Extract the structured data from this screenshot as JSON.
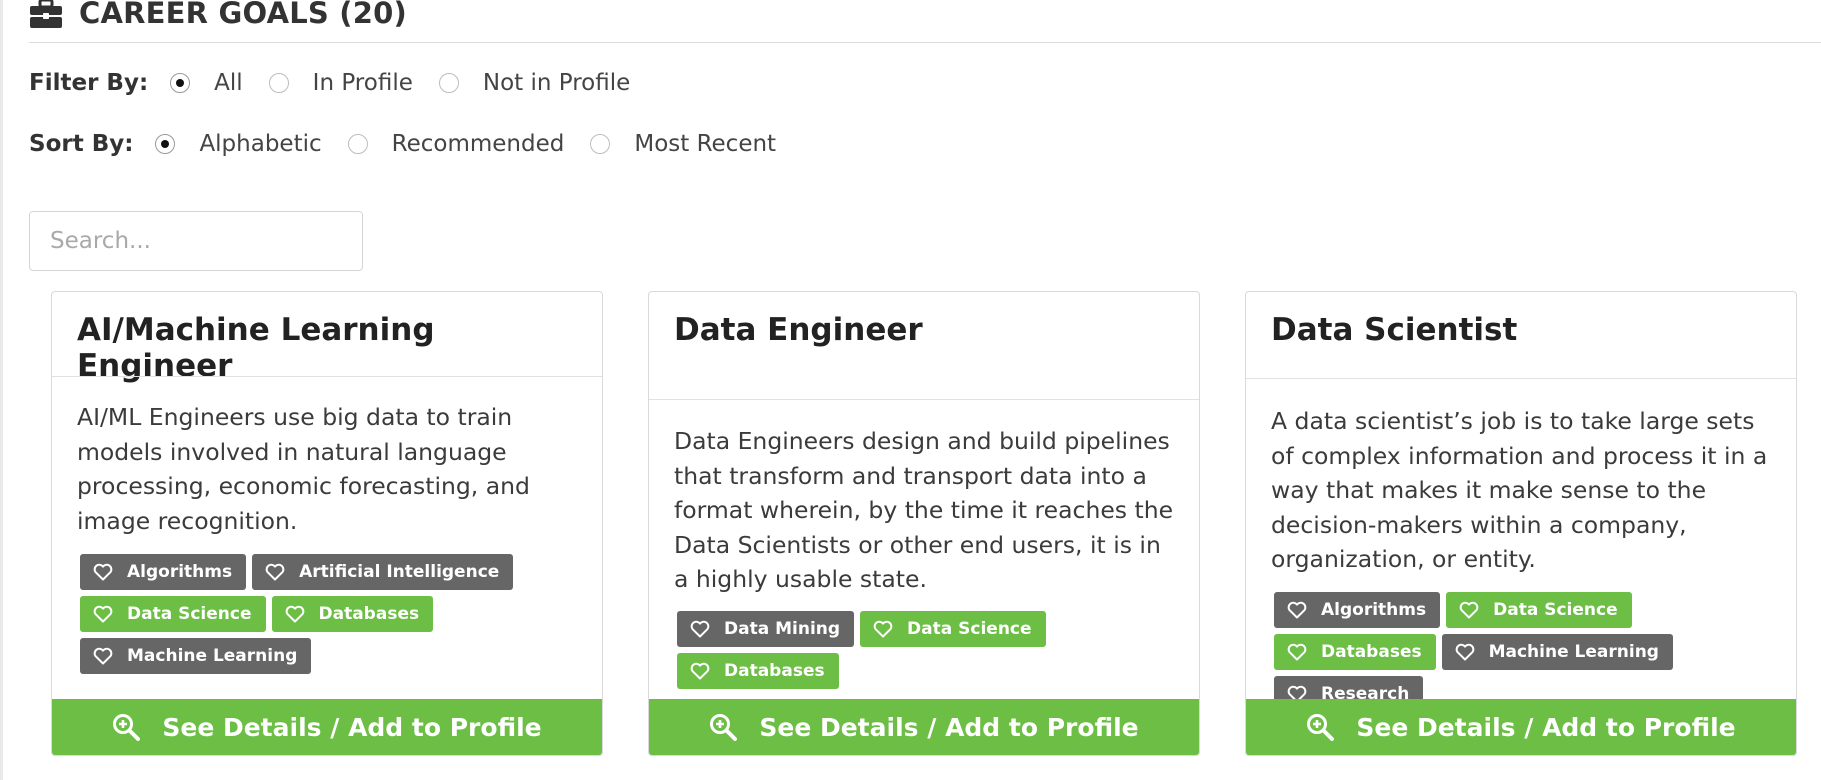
{
  "section": {
    "title": "CAREER GOALS (20)",
    "icon": "briefcase-icon"
  },
  "filter": {
    "label": "Filter By:",
    "options": [
      "All",
      "In Profile",
      "Not in Profile"
    ],
    "selected": "All"
  },
  "sort": {
    "label": "Sort By:",
    "options": [
      "Alphabetic",
      "Recommended",
      "Most Recent"
    ],
    "selected": "Alphabetic"
  },
  "search": {
    "placeholder": "Search..."
  },
  "colors": {
    "accent_green": "#6cbe45",
    "tag_gray": "#666666"
  },
  "cards": [
    {
      "title": "AI/Machine Learning Engineer",
      "description": "AI/ML Engineers use big data to train models involved in natural language processing, economic forecasting, and image recognition.",
      "tags": [
        {
          "label": "Algorithms",
          "style": "gray"
        },
        {
          "label": "Artificial Intelligence",
          "style": "gray"
        },
        {
          "label": "Data Science",
          "style": "green"
        },
        {
          "label": "Databases",
          "style": "green"
        },
        {
          "label": "Machine Learning",
          "style": "gray"
        }
      ],
      "button_label": "See Details / Add to Profile"
    },
    {
      "title": "Data Engineer",
      "description": "Data Engineers design and build pipelines that transform and transport data into a format wherein, by the time it reaches the Data Scientists or other end users, it is in a highly usable state.",
      "tags": [
        {
          "label": "Data Mining",
          "style": "gray"
        },
        {
          "label": "Data Science",
          "style": "green"
        },
        {
          "label": "Databases",
          "style": "green"
        }
      ],
      "button_label": "See Details / Add to Profile"
    },
    {
      "title": "Data Scientist",
      "description": "A data scientist’s job is to take large sets of complex information and process it in a way that makes it make sense to the decision-makers within a company, organization, or entity.",
      "tags": [
        {
          "label": "Algorithms",
          "style": "gray"
        },
        {
          "label": "Data Science",
          "style": "green"
        },
        {
          "label": "Databases",
          "style": "green"
        },
        {
          "label": "Machine Learning",
          "style": "gray"
        },
        {
          "label": "Research",
          "style": "gray"
        }
      ],
      "button_label": "See Details / Add to Profile"
    }
  ]
}
